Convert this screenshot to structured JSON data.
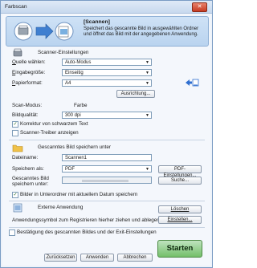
{
  "window": {
    "title": "Farbscan",
    "close_icon": "close-icon"
  },
  "header": {
    "title": "[Scannen]",
    "description": "Speichert das gescannte Bild in ausgewählten Ordner und öffnet das Bild mit der angegebenen Anwendung."
  },
  "scanner_settings": {
    "heading": "Scanner-Einstellungen",
    "source_label_u": "Q",
    "source_label_rest": "uelle wählen:",
    "source_value": "Auto-Modus",
    "input_label_u": "E",
    "input_label_rest": "ingabegröße:",
    "input_value": "Einseitig",
    "paper_label_u": "P",
    "paper_label_rest": "apierformat:",
    "paper_value": "A4",
    "paper_side_icon": "page-orientation-icon",
    "adjust_button": "Ausrichtung...",
    "color_mode_label": "Scan-Modus:",
    "color_mode_value": "Farbe",
    "quality_label": "Bildqualität:",
    "quality_value": "300 dpi",
    "correct_text_label": "Korrektur von schwarzem Text",
    "correct_text_checked": true,
    "show_driver_label": "Scanner-Treiber anzeigen",
    "show_driver_checked": false
  },
  "save_settings": {
    "heading": "Gescanntes Bild speichern unter",
    "filename_label": "Dateiname:",
    "filename_value": "Scannen1",
    "save_as_label": "Speichern als:",
    "save_as_value": "PDF",
    "pdf_settings_button": "PDF-Einstellungen...",
    "save_in_label_line1": "Gescanntes Bild",
    "save_in_label_line2": "speichern unter:",
    "browse_button": "Suche...",
    "subfolder_label": "Bilder in Unterordner mit aktuellem Datum speichern",
    "subfolder_checked": true
  },
  "external_app": {
    "heading": "Externe Anwendung",
    "delete_button": "Löschen",
    "drag_hint": "Anwendungssymbol zum Registrieren hierher ziehen und ablegen.",
    "settings_button": "Einstellen..."
  },
  "footer": {
    "confirm_label": "Bestätigung des gescannten Bildes und der Exit-Einstellungen",
    "confirm_checked": false,
    "back_button": "Zurücksetzen",
    "apply_button": "Anwenden",
    "cancel_button": "Abbrechen",
    "start_button": "Starten"
  }
}
